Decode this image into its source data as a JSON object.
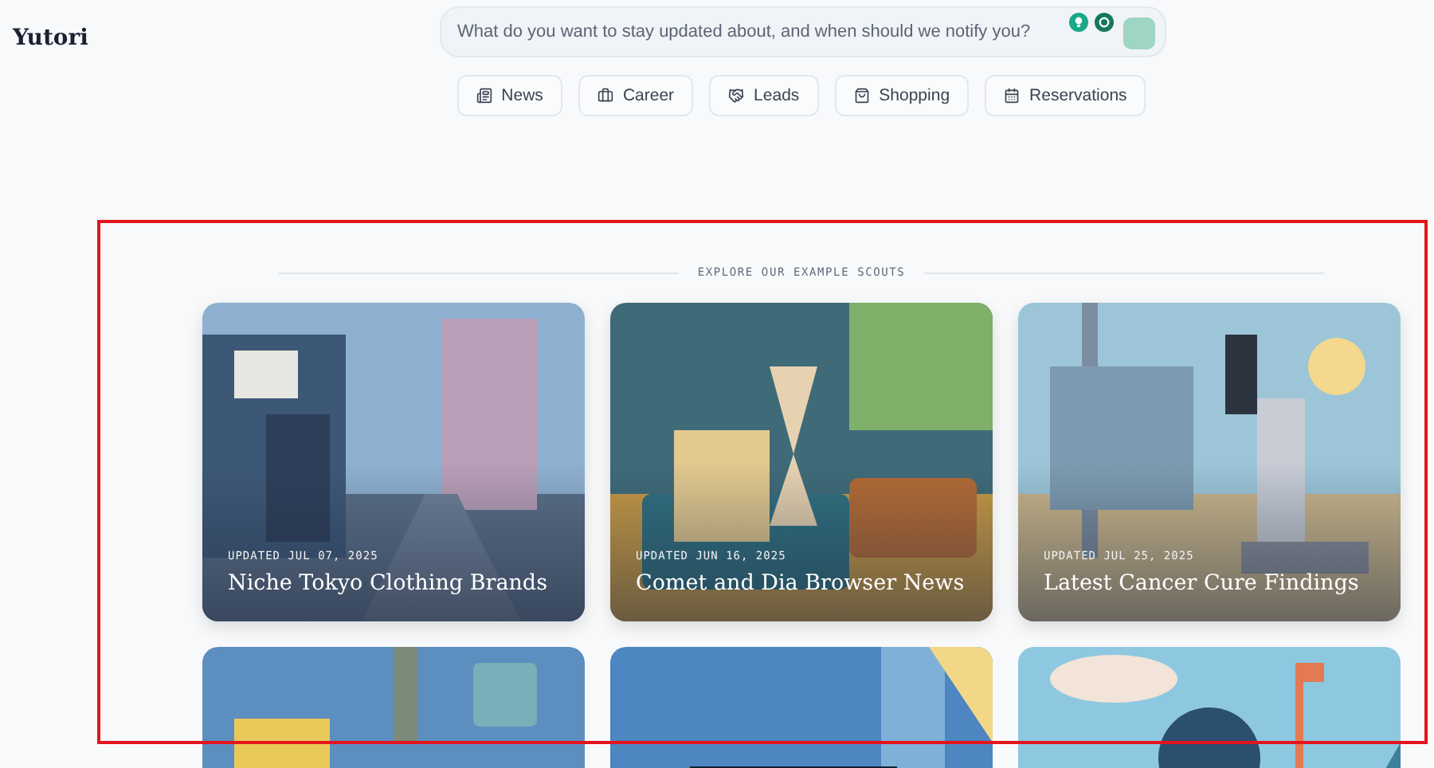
{
  "logo": "Yutori",
  "search": {
    "placeholder": "What do you want to stay updated about, and when should we notify you?"
  },
  "categories": [
    {
      "label": "News"
    },
    {
      "label": "Career"
    },
    {
      "label": "Leads"
    },
    {
      "label": "Shopping"
    },
    {
      "label": "Reservations"
    }
  ],
  "section_title": "EXPLORE OUR EXAMPLE SCOUTS",
  "scouts": [
    {
      "kind": "scout",
      "updated": "UPDATED JUL 07, 2025",
      "title": "Niche Tokyo Clothing Brands"
    },
    {
      "kind": "scout",
      "updated": "UPDATED JUN 16, 2025",
      "title": "Comet and Dia Browser News"
    },
    {
      "kind": "scout",
      "updated": "UPDATED JUL 25, 2025",
      "title": "Latest Cancer Cure Findings"
    },
    {
      "kind": "picture"
    },
    {
      "kind": "picture"
    },
    {
      "kind": "picture"
    }
  ],
  "highlight": {
    "shown": true
  }
}
